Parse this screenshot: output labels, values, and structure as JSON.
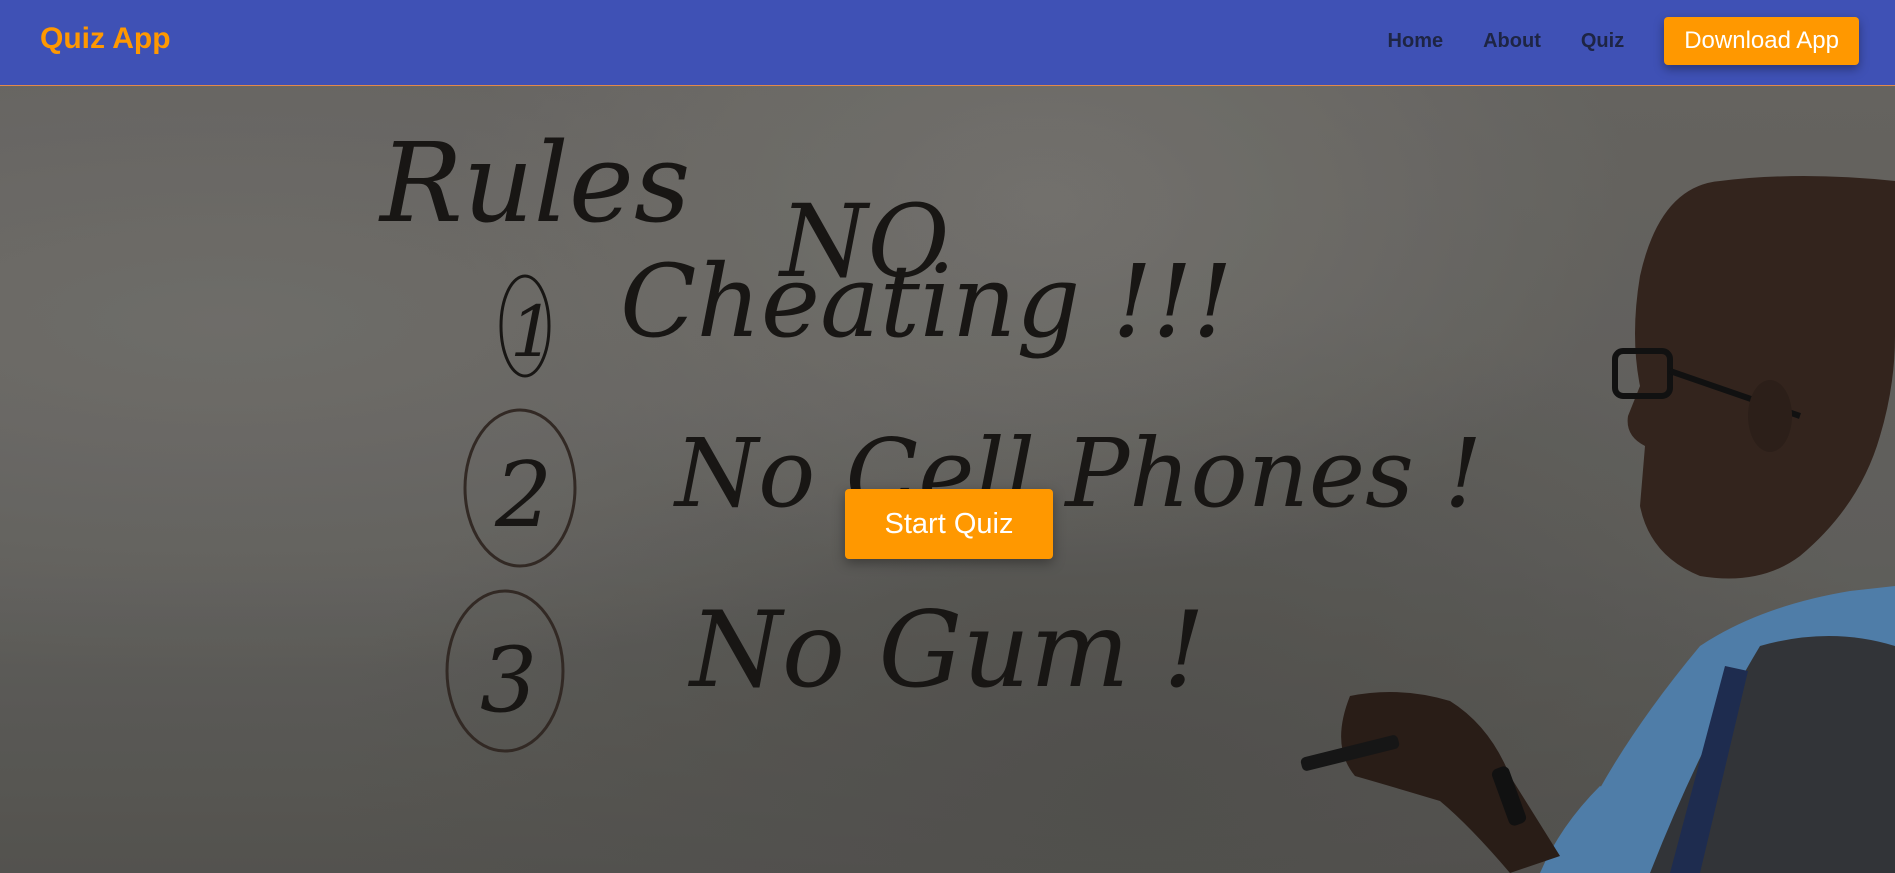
{
  "header": {
    "brand": "Quiz App",
    "nav": [
      {
        "label": "Home"
      },
      {
        "label": "About"
      },
      {
        "label": "Quiz"
      }
    ],
    "download_label": "Download App"
  },
  "hero": {
    "start_label": "Start Quiz",
    "whiteboard": {
      "title": "Rules",
      "no_label": "NO",
      "rules": [
        {
          "number": "1",
          "text": "Cheating !!!"
        },
        {
          "number": "2",
          "text": "No Cell Phones !"
        },
        {
          "number": "3",
          "text": "No Gum !"
        }
      ]
    }
  },
  "colors": {
    "navbar": "#3f51b5",
    "accent": "#ff9800",
    "nav_text": "#1e2544"
  }
}
